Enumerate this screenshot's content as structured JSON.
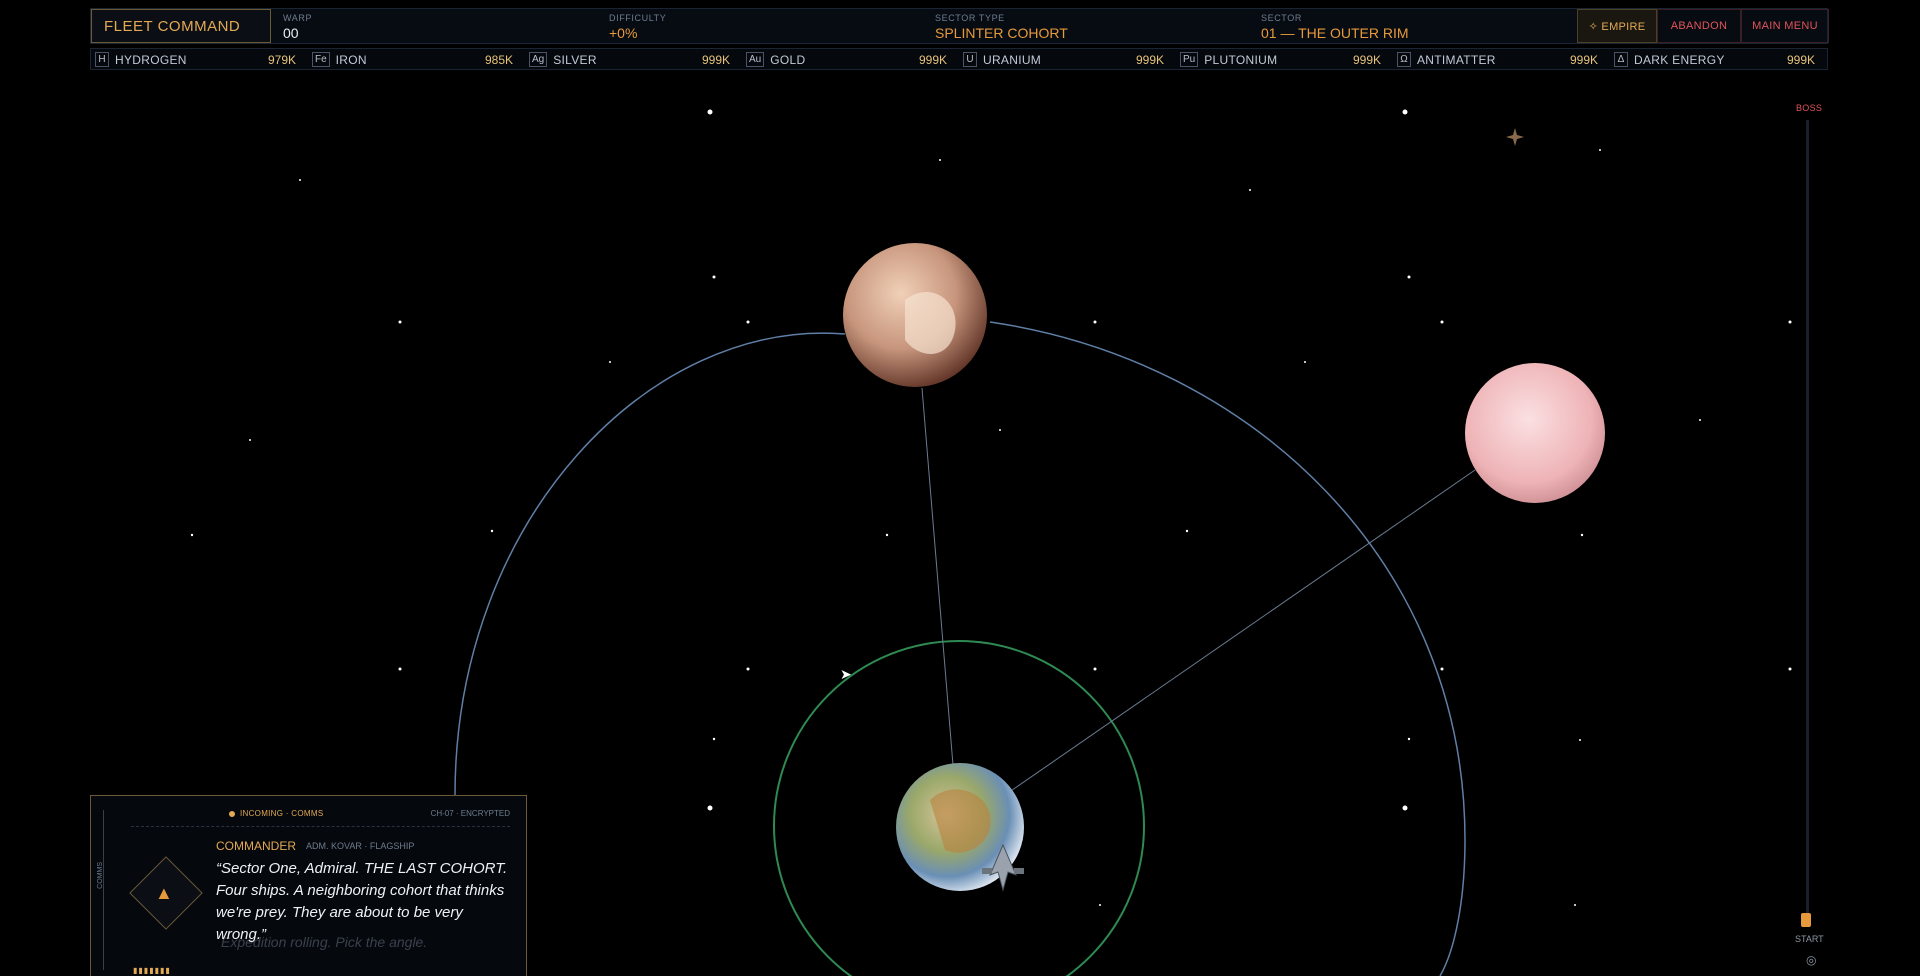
{
  "header": {
    "brand": "FLEET COMMAND",
    "warp": {
      "label": "WARP",
      "value": "00"
    },
    "difficulty": {
      "label": "DIFFICULTY",
      "value": "+0%"
    },
    "sector_type": {
      "label": "SECTOR TYPE",
      "value": "SPLINTER COHORT"
    },
    "sector": {
      "label": "SECTOR",
      "value": "01 — THE OUTER RIM"
    },
    "buttons": {
      "empire": "✧ EMPIRE",
      "abandon": "ABANDON",
      "main_menu": "MAIN MENU"
    }
  },
  "resources": [
    {
      "symbol": "H",
      "name": "HYDROGEN",
      "amount": "979K"
    },
    {
      "symbol": "Fe",
      "name": "IRON",
      "amount": "985K"
    },
    {
      "symbol": "Ag",
      "name": "SILVER",
      "amount": "999K"
    },
    {
      "symbol": "Au",
      "name": "GOLD",
      "amount": "999K"
    },
    {
      "symbol": "U",
      "name": "URANIUM",
      "amount": "999K"
    },
    {
      "symbol": "Pu",
      "name": "PLUTONIUM",
      "amount": "999K"
    },
    {
      "symbol": "Ω",
      "name": "ANTIMATTER",
      "amount": "999K"
    },
    {
      "symbol": "Δ",
      "name": "DARK ENERGY",
      "amount": "999K"
    }
  ],
  "map": {
    "boss_label": "BOSS",
    "start_label": "START"
  },
  "comms": {
    "header": "INCOMING · COMMS",
    "channel": "CH-07 · ENCRYPTED",
    "side_label": "COMMS",
    "speaker": "COMMANDER",
    "role": "ADM. KOVAR · FLAGSHIP",
    "quote": "“Sector One, Admiral. THE LAST COHORT. Four ships. A neighboring cohort that thinks we're prey. They are about to be very wrong.”",
    "ghost": "Expedition rolling. Pick the angle."
  },
  "colors": {
    "accent": "#e3a954",
    "danger": "#e0555a",
    "orbit": "#5f7fa6",
    "home_orbit": "#2f8a52"
  }
}
